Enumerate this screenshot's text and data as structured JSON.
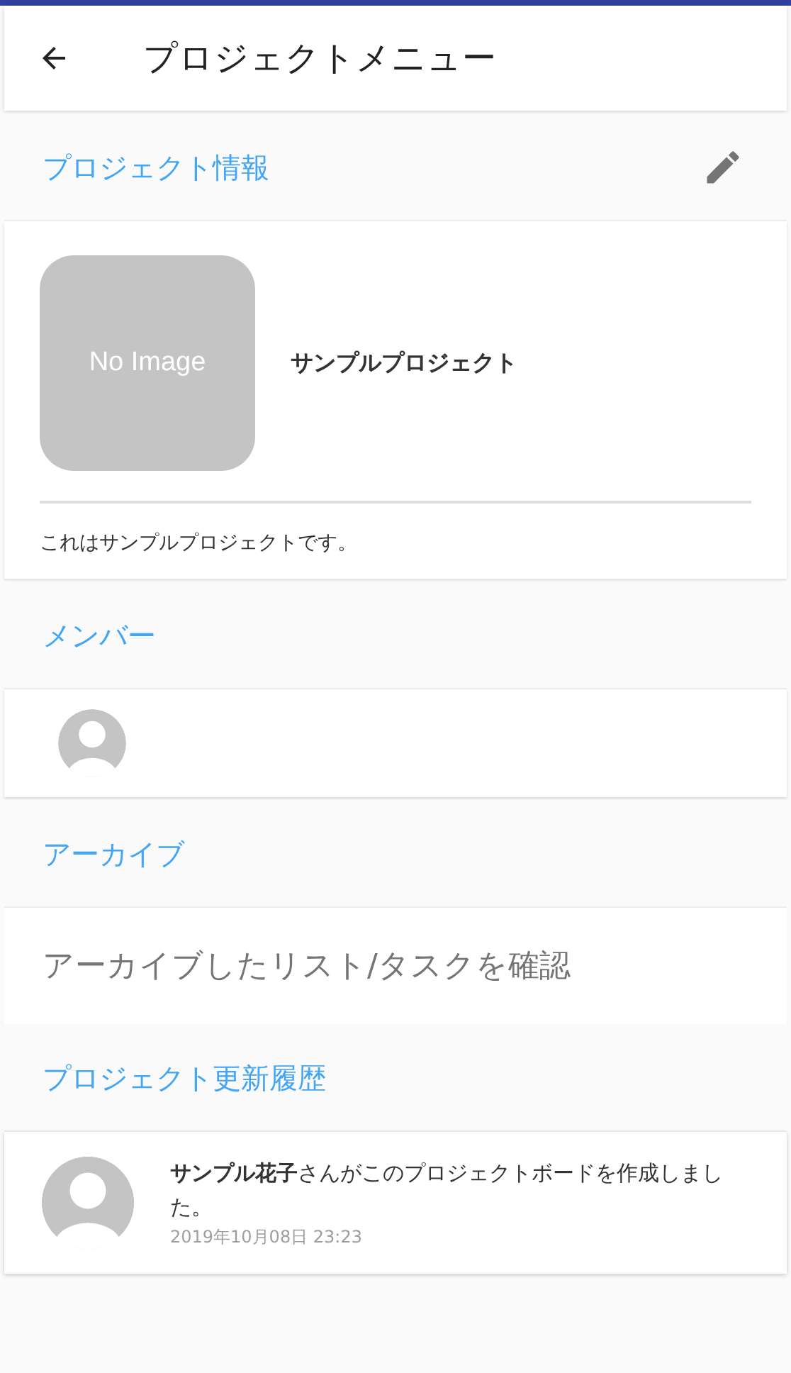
{
  "app_bar": {
    "title": "プロジェクトメニュー"
  },
  "project_info": {
    "heading": "プロジェクト情報",
    "image_placeholder": "No Image",
    "name": "サンプルプロジェクト",
    "description": "これはサンプルプロジェクトです。"
  },
  "members": {
    "heading": "メンバー",
    "items": [
      {
        "kind": "avatar"
      }
    ]
  },
  "archive": {
    "heading": "アーカイブ",
    "link": "アーカイブしたリスト/タスクを確認"
  },
  "history": {
    "heading": "プロジェクト更新履歴",
    "items": [
      {
        "message": "**サンプル花子**さんがこのプロジェクトボードを作成しました。",
        "timestamp": "2019年10月08日 23:23"
      }
    ]
  }
}
